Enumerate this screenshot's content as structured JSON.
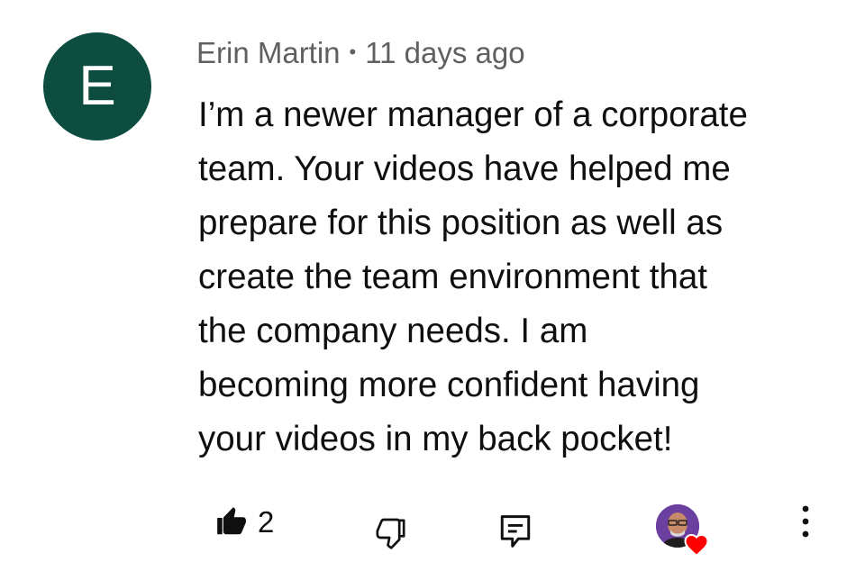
{
  "comment": {
    "avatar_letter": "E",
    "avatar_color": "#0c4d40",
    "author": "Erin Martin",
    "separator": "•",
    "time": "11 days ago",
    "text": "I’m a newer manager of a corporate\nteam.  Your videos have helped me\nprepare for this position as well as\ncreate the team environment that\nthe company needs.  I am\nbecoming more confident having\nyour videos in my back pocket!"
  },
  "actions": {
    "like_count": "2",
    "like_icon": "thumbs-up-filled-icon",
    "dislike_icon": "thumbs-down-icon",
    "reply_icon": "reply-comment-icon",
    "creator_heart_icon": "heart-icon",
    "more_icon": "more-vertical-icon",
    "heart_color": "#ff0000"
  }
}
